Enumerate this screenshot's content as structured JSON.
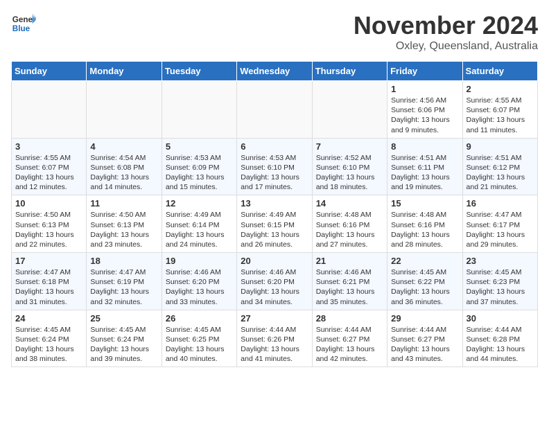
{
  "header": {
    "logo_general": "General",
    "logo_blue": "Blue",
    "month_title": "November 2024",
    "subtitle": "Oxley, Queensland, Australia"
  },
  "days_of_week": [
    "Sunday",
    "Monday",
    "Tuesday",
    "Wednesday",
    "Thursday",
    "Friday",
    "Saturday"
  ],
  "weeks": [
    [
      {
        "day": "",
        "info": ""
      },
      {
        "day": "",
        "info": ""
      },
      {
        "day": "",
        "info": ""
      },
      {
        "day": "",
        "info": ""
      },
      {
        "day": "",
        "info": ""
      },
      {
        "day": "1",
        "info": "Sunrise: 4:56 AM\nSunset: 6:06 PM\nDaylight: 13 hours and 9 minutes."
      },
      {
        "day": "2",
        "info": "Sunrise: 4:55 AM\nSunset: 6:07 PM\nDaylight: 13 hours and 11 minutes."
      }
    ],
    [
      {
        "day": "3",
        "info": "Sunrise: 4:55 AM\nSunset: 6:07 PM\nDaylight: 13 hours and 12 minutes."
      },
      {
        "day": "4",
        "info": "Sunrise: 4:54 AM\nSunset: 6:08 PM\nDaylight: 13 hours and 14 minutes."
      },
      {
        "day": "5",
        "info": "Sunrise: 4:53 AM\nSunset: 6:09 PM\nDaylight: 13 hours and 15 minutes."
      },
      {
        "day": "6",
        "info": "Sunrise: 4:53 AM\nSunset: 6:10 PM\nDaylight: 13 hours and 17 minutes."
      },
      {
        "day": "7",
        "info": "Sunrise: 4:52 AM\nSunset: 6:10 PM\nDaylight: 13 hours and 18 minutes."
      },
      {
        "day": "8",
        "info": "Sunrise: 4:51 AM\nSunset: 6:11 PM\nDaylight: 13 hours and 19 minutes."
      },
      {
        "day": "9",
        "info": "Sunrise: 4:51 AM\nSunset: 6:12 PM\nDaylight: 13 hours and 21 minutes."
      }
    ],
    [
      {
        "day": "10",
        "info": "Sunrise: 4:50 AM\nSunset: 6:13 PM\nDaylight: 13 hours and 22 minutes."
      },
      {
        "day": "11",
        "info": "Sunrise: 4:50 AM\nSunset: 6:13 PM\nDaylight: 13 hours and 23 minutes."
      },
      {
        "day": "12",
        "info": "Sunrise: 4:49 AM\nSunset: 6:14 PM\nDaylight: 13 hours and 24 minutes."
      },
      {
        "day": "13",
        "info": "Sunrise: 4:49 AM\nSunset: 6:15 PM\nDaylight: 13 hours and 26 minutes."
      },
      {
        "day": "14",
        "info": "Sunrise: 4:48 AM\nSunset: 6:16 PM\nDaylight: 13 hours and 27 minutes."
      },
      {
        "day": "15",
        "info": "Sunrise: 4:48 AM\nSunset: 6:16 PM\nDaylight: 13 hours and 28 minutes."
      },
      {
        "day": "16",
        "info": "Sunrise: 4:47 AM\nSunset: 6:17 PM\nDaylight: 13 hours and 29 minutes."
      }
    ],
    [
      {
        "day": "17",
        "info": "Sunrise: 4:47 AM\nSunset: 6:18 PM\nDaylight: 13 hours and 31 minutes."
      },
      {
        "day": "18",
        "info": "Sunrise: 4:47 AM\nSunset: 6:19 PM\nDaylight: 13 hours and 32 minutes."
      },
      {
        "day": "19",
        "info": "Sunrise: 4:46 AM\nSunset: 6:20 PM\nDaylight: 13 hours and 33 minutes."
      },
      {
        "day": "20",
        "info": "Sunrise: 4:46 AM\nSunset: 6:20 PM\nDaylight: 13 hours and 34 minutes."
      },
      {
        "day": "21",
        "info": "Sunrise: 4:46 AM\nSunset: 6:21 PM\nDaylight: 13 hours and 35 minutes."
      },
      {
        "day": "22",
        "info": "Sunrise: 4:45 AM\nSunset: 6:22 PM\nDaylight: 13 hours and 36 minutes."
      },
      {
        "day": "23",
        "info": "Sunrise: 4:45 AM\nSunset: 6:23 PM\nDaylight: 13 hours and 37 minutes."
      }
    ],
    [
      {
        "day": "24",
        "info": "Sunrise: 4:45 AM\nSunset: 6:24 PM\nDaylight: 13 hours and 38 minutes."
      },
      {
        "day": "25",
        "info": "Sunrise: 4:45 AM\nSunset: 6:24 PM\nDaylight: 13 hours and 39 minutes."
      },
      {
        "day": "26",
        "info": "Sunrise: 4:45 AM\nSunset: 6:25 PM\nDaylight: 13 hours and 40 minutes."
      },
      {
        "day": "27",
        "info": "Sunrise: 4:44 AM\nSunset: 6:26 PM\nDaylight: 13 hours and 41 minutes."
      },
      {
        "day": "28",
        "info": "Sunrise: 4:44 AM\nSunset: 6:27 PM\nDaylight: 13 hours and 42 minutes."
      },
      {
        "day": "29",
        "info": "Sunrise: 4:44 AM\nSunset: 6:27 PM\nDaylight: 13 hours and 43 minutes."
      },
      {
        "day": "30",
        "info": "Sunrise: 4:44 AM\nSunset: 6:28 PM\nDaylight: 13 hours and 44 minutes."
      }
    ]
  ]
}
